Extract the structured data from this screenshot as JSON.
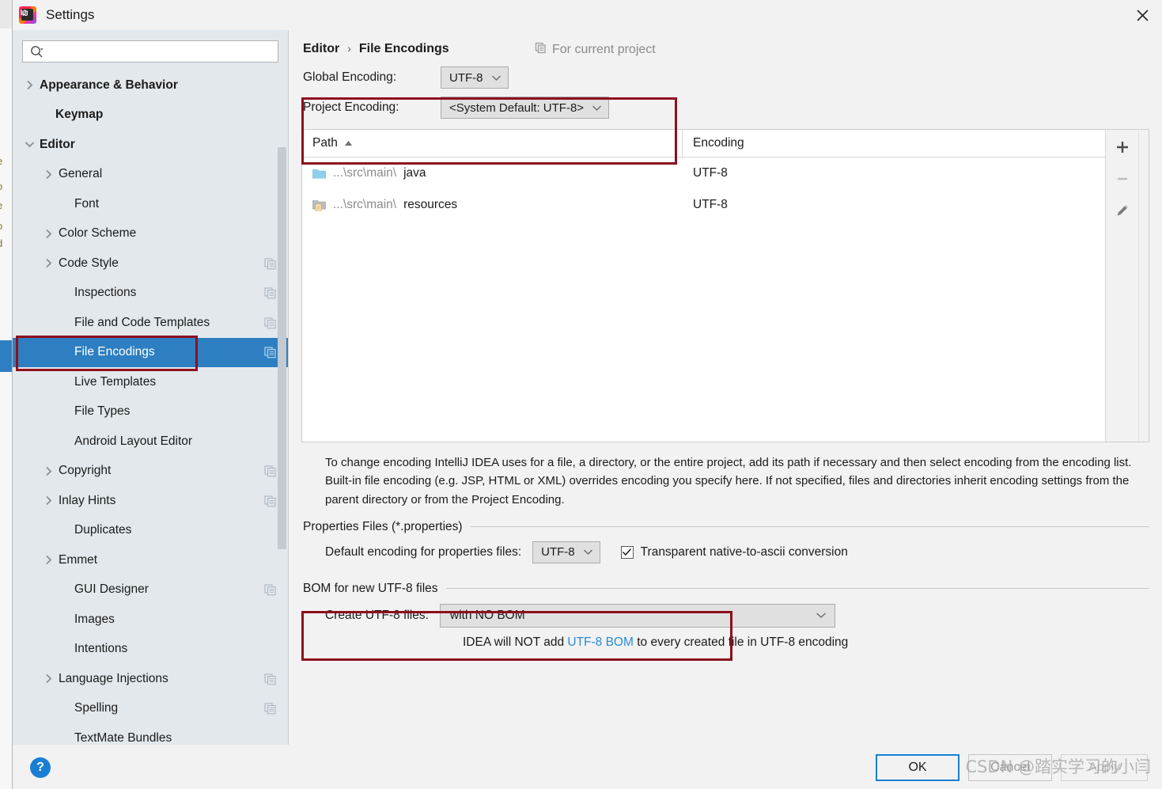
{
  "window": {
    "title": "Settings",
    "app_icon": "intellij-idea-icon",
    "close_icon": "close-icon"
  },
  "sidebar": {
    "search": {
      "placeholder": "",
      "value": "",
      "icon": "search-icon"
    },
    "items": [
      {
        "label": "Appearance & Behavior",
        "arrow": "collapsed",
        "bold": true,
        "indent": 14,
        "config": false,
        "selected": false
      },
      {
        "label": "Keymap",
        "arrow": "none",
        "bold": true,
        "indent": 34,
        "config": false,
        "selected": false
      },
      {
        "label": "Editor",
        "arrow": "expanded",
        "bold": true,
        "indent": 14,
        "config": false,
        "selected": false
      },
      {
        "label": "General",
        "arrow": "collapsed",
        "bold": false,
        "indent": 38,
        "config": false,
        "selected": false
      },
      {
        "label": "Font",
        "arrow": "none",
        "bold": false,
        "indent": 58,
        "config": false,
        "selected": false
      },
      {
        "label": "Color Scheme",
        "arrow": "collapsed",
        "bold": false,
        "indent": 38,
        "config": false,
        "selected": false
      },
      {
        "label": "Code Style",
        "arrow": "collapsed",
        "bold": false,
        "indent": 38,
        "config": true,
        "selected": false
      },
      {
        "label": "Inspections",
        "arrow": "none",
        "bold": false,
        "indent": 58,
        "config": true,
        "selected": false
      },
      {
        "label": "File and Code Templates",
        "arrow": "none",
        "bold": false,
        "indent": 58,
        "config": true,
        "selected": false
      },
      {
        "label": "File Encodings",
        "arrow": "none",
        "bold": false,
        "indent": 58,
        "config": true,
        "selected": true
      },
      {
        "label": "Live Templates",
        "arrow": "none",
        "bold": false,
        "indent": 58,
        "config": false,
        "selected": false
      },
      {
        "label": "File Types",
        "arrow": "none",
        "bold": false,
        "indent": 58,
        "config": false,
        "selected": false
      },
      {
        "label": "Android Layout Editor",
        "arrow": "none",
        "bold": false,
        "indent": 58,
        "config": false,
        "selected": false
      },
      {
        "label": "Copyright",
        "arrow": "collapsed",
        "bold": false,
        "indent": 38,
        "config": true,
        "selected": false
      },
      {
        "label": "Inlay Hints",
        "arrow": "collapsed",
        "bold": false,
        "indent": 38,
        "config": true,
        "selected": false
      },
      {
        "label": "Duplicates",
        "arrow": "none",
        "bold": false,
        "indent": 58,
        "config": false,
        "selected": false
      },
      {
        "label": "Emmet",
        "arrow": "collapsed",
        "bold": false,
        "indent": 38,
        "config": false,
        "selected": false
      },
      {
        "label": "GUI Designer",
        "arrow": "none",
        "bold": false,
        "indent": 58,
        "config": true,
        "selected": false
      },
      {
        "label": "Images",
        "arrow": "none",
        "bold": false,
        "indent": 58,
        "config": false,
        "selected": false
      },
      {
        "label": "Intentions",
        "arrow": "none",
        "bold": false,
        "indent": 58,
        "config": false,
        "selected": false
      },
      {
        "label": "Language Injections",
        "arrow": "collapsed",
        "bold": false,
        "indent": 38,
        "config": true,
        "selected": false
      },
      {
        "label": "Spelling",
        "arrow": "none",
        "bold": false,
        "indent": 58,
        "config": true,
        "selected": false
      },
      {
        "label": "TextMate Bundles",
        "arrow": "none",
        "bold": false,
        "indent": 58,
        "config": false,
        "selected": false
      }
    ]
  },
  "content": {
    "breadcrumb": {
      "parent": "Editor",
      "separator": "›",
      "current": "File Encodings"
    },
    "for_current_project": {
      "label": "For current project",
      "icon": "copy-config-icon"
    },
    "encoding": {
      "global_label": "Global Encoding:",
      "global_value": "UTF-8",
      "project_label": "Project Encoding:",
      "project_value": "<System Default: UTF-8>"
    },
    "table": {
      "columns": [
        "Path",
        "Encoding"
      ],
      "sort_column": "Path",
      "sort_direction": "ascending",
      "rows": [
        {
          "path_prefix": "...\\src\\main\\",
          "path_name": "java",
          "icon": "folder-icon",
          "encoding": "UTF-8"
        },
        {
          "path_prefix": "...\\src\\main\\",
          "path_name": "resources",
          "icon": "folder-resources-icon",
          "encoding": "UTF-8"
        }
      ],
      "toolbar": [
        {
          "name": "add-button",
          "icon": "plus-icon",
          "enabled": true
        },
        {
          "name": "remove-button",
          "icon": "minus-icon",
          "enabled": false
        },
        {
          "name": "edit-button",
          "icon": "pencil-icon",
          "enabled": true
        }
      ]
    },
    "description": "To change encoding IntelliJ IDEA uses for a file, a directory, or the entire project, add its path if necessary and then select encoding from the encoding list. Built-in file encoding (e.g. JSP, HTML or XML) overrides encoding you specify here. If not specified, files and directories inherit encoding settings from the parent directory or from the Project Encoding.",
    "properties_section": {
      "title": "Properties Files (*.properties)",
      "default_encoding_label": "Default encoding for properties files:",
      "default_encoding_value": "UTF-8",
      "transparent_label": "Transparent native-to-ascii conversion",
      "transparent_checked": true
    },
    "bom_section": {
      "title": "BOM for new UTF-8 files",
      "create_label": "Create UTF-8 files:",
      "create_value": "with NO BOM",
      "note_prefix": "IDEA will NOT add ",
      "note_link": "UTF-8 BOM",
      "note_suffix": " to every created file in UTF-8 encoding"
    }
  },
  "footer": {
    "help_label": "?",
    "ok_label": "OK",
    "cancel_label": "Cancel",
    "apply_label": "Apply"
  },
  "watermark": "CSDN @踏实学习的小闫",
  "colors": {
    "accent": "#2d7fc1",
    "annotation": "#8e0f1e",
    "sidebar_bg": "#e2e8ec",
    "link": "#2b8ad6"
  }
}
